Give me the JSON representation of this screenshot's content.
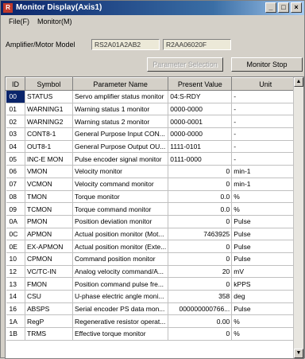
{
  "window": {
    "title": "Monitor Display(Axis1)",
    "icon_letter": "R",
    "min": "_",
    "max": "□",
    "close": "×"
  },
  "menu": {
    "file": "File(F)",
    "monitor": "Monitor(M)"
  },
  "model": {
    "label": "Amplifier/Motor Model",
    "amp": "RS2A01A2AB2",
    "motor": "R2AA06020F"
  },
  "buttons": {
    "param_select": "Parameter Selection",
    "monitor_stop": "Monitor Stop"
  },
  "table": {
    "headers": [
      "ID",
      "Symbol",
      "Parameter Name",
      "Present Value",
      "Unit"
    ],
    "rows": [
      {
        "id": "00",
        "symbol": "STATUS",
        "name": "Servo amplifier status monitor",
        "value": "04:S-RDY",
        "unit": "-",
        "align": "L"
      },
      {
        "id": "01",
        "symbol": "WARNING1",
        "name": "Warning status 1 monitor",
        "value": "0000-0000",
        "unit": "-",
        "align": "L"
      },
      {
        "id": "02",
        "symbol": "WARNING2",
        "name": "Warning status 2 monitor",
        "value": "0000-0001",
        "unit": "-",
        "align": "L"
      },
      {
        "id": "03",
        "symbol": "CONT8-1",
        "name": "General Purpose Input CON...",
        "value": "0000-0000",
        "unit": "-",
        "align": "L"
      },
      {
        "id": "04",
        "symbol": "OUT8-1",
        "name": "General Purpose Output OU...",
        "value": "1111-0101",
        "unit": "-",
        "align": "L"
      },
      {
        "id": "05",
        "symbol": "INC-E MON",
        "name": "Pulse encoder signal monitor",
        "value": "0111-0000",
        "unit": "-",
        "align": "L"
      },
      {
        "id": "06",
        "symbol": "VMON",
        "name": "Velocity monitor",
        "value": "0",
        "unit": "min-1",
        "align": "R"
      },
      {
        "id": "07",
        "symbol": "VCMON",
        "name": "Velocity command monitor",
        "value": "0",
        "unit": "min-1",
        "align": "R"
      },
      {
        "id": "08",
        "symbol": "TMON",
        "name": "Torque monitor",
        "value": "0.0",
        "unit": "%",
        "align": "R"
      },
      {
        "id": "09",
        "symbol": "TCMON",
        "name": "Torque command monitor",
        "value": "0.0",
        "unit": "%",
        "align": "R"
      },
      {
        "id": "0A",
        "symbol": "PMON",
        "name": "Position deviation monitor",
        "value": "0",
        "unit": "Pulse",
        "align": "R"
      },
      {
        "id": "0C",
        "symbol": "APMON",
        "name": "Actual position monitor (Mot...",
        "value": "7463925",
        "unit": "Pulse",
        "align": "R"
      },
      {
        "id": "0E",
        "symbol": "EX-APMON",
        "name": "Actual position monitor (Exte...",
        "value": "0",
        "unit": "Pulse",
        "align": "R"
      },
      {
        "id": "10",
        "symbol": "CPMON",
        "name": "Command position monitor",
        "value": "0",
        "unit": "Pulse",
        "align": "R"
      },
      {
        "id": "12",
        "symbol": "VC/TC-IN",
        "name": "Analog velocity command/A...",
        "value": "20",
        "unit": "mV",
        "align": "R"
      },
      {
        "id": "13",
        "symbol": "FMON",
        "name": "Position command pulse fre...",
        "value": "0",
        "unit": "kPPS",
        "align": "R"
      },
      {
        "id": "14",
        "symbol": "CSU",
        "name": "U-phase electric angle moni...",
        "value": "358",
        "unit": "deg",
        "align": "R"
      },
      {
        "id": "16",
        "symbol": "ABSPS",
        "name": "Serial encoder PS data mon...",
        "value": "000000000766...",
        "unit": "Pulse",
        "align": "R"
      },
      {
        "id": "1A",
        "symbol": "RegP",
        "name": "Regenerative resistor operat...",
        "value": "0.00",
        "unit": "%",
        "align": "R"
      },
      {
        "id": "1B",
        "symbol": "TRMS",
        "name": "Effective torque monitor",
        "value": "0",
        "unit": "%",
        "align": "R"
      }
    ]
  }
}
